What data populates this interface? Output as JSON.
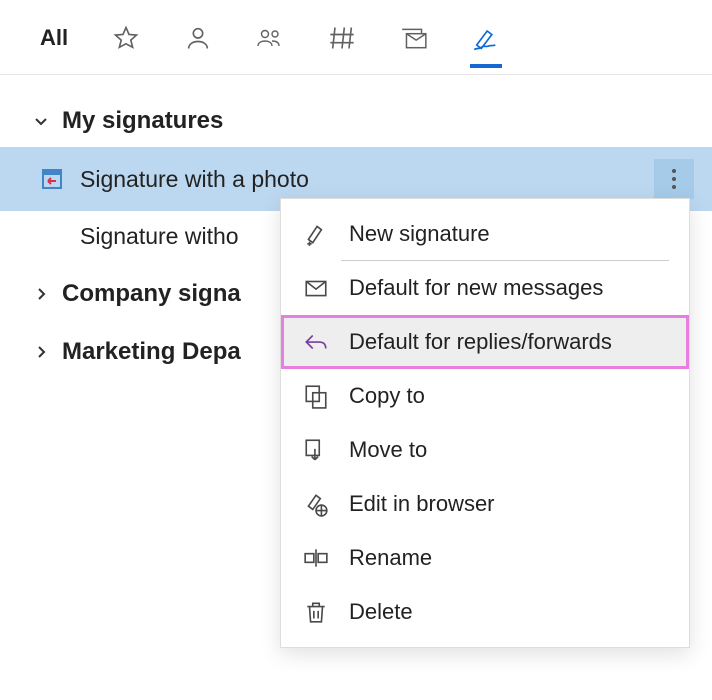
{
  "tabs": {
    "all": "All"
  },
  "tree": {
    "my_signatures": "My signatures",
    "sig_with_photo": "Signature with a photo",
    "sig_without": "Signature witho",
    "company": "Company signa",
    "marketing": "Marketing Depa"
  },
  "menu": {
    "new_signature": "New signature",
    "default_new": "Default for new messages",
    "default_replies": "Default for replies/forwards",
    "copy_to": "Copy to",
    "move_to": "Move to",
    "edit_browser": "Edit in browser",
    "rename": "Rename",
    "delete": "Delete"
  }
}
